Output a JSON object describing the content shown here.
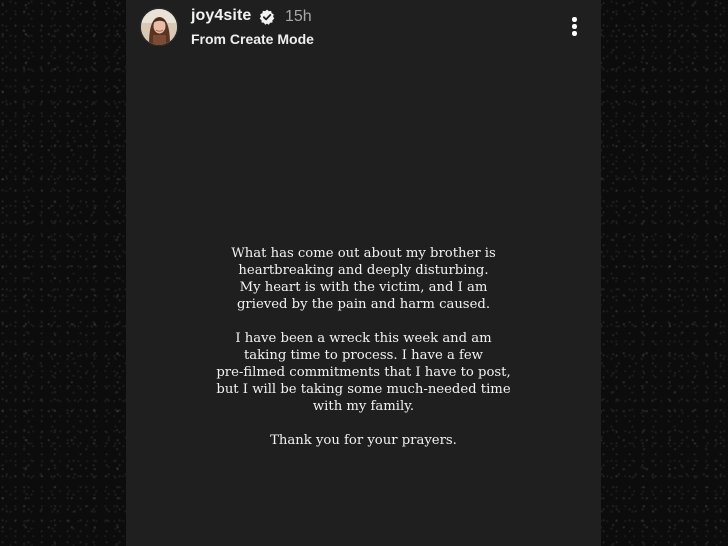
{
  "story": {
    "username": "joy4site",
    "time_ago": "15h",
    "subtitle": "From Create Mode",
    "verified": true,
    "icons": {
      "verified": "verified-badge-icon",
      "more": "more-options-icon"
    },
    "colors": {
      "story_background": "#1f1f1f",
      "page_background": "#0c0c0c",
      "text": "#f2f2f2",
      "muted_text": "#a8a8a8"
    },
    "message": {
      "paragraphs": [
        {
          "lines": [
            "What has come out about my brother is",
            "heartbreaking and deeply disturbing.",
            "My heart is with the victim, and I am",
            "grieved by the pain and harm caused."
          ]
        },
        {
          "lines": [
            "I have been a wreck this week and am",
            "taking time to process. I have a few",
            "pre-filmed commitments that I have to post,",
            "but I will be taking some much-needed time",
            "with my family."
          ]
        },
        {
          "lines": [
            "Thank you for your prayers."
          ]
        }
      ]
    }
  }
}
